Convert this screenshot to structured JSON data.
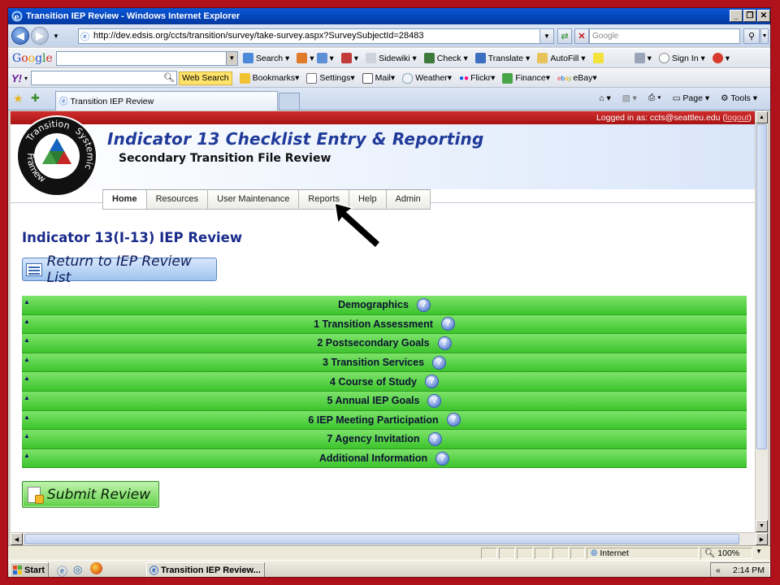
{
  "window": {
    "title": "Transition IEP Review - Windows Internet Explorer",
    "controls": [
      "_",
      "Θ",
      "X"
    ]
  },
  "address_bar": {
    "url": "http://dev.edsis.org/ccts/transition/survey/take-survey.aspx?SurveySubjectId=28483",
    "search_placeholder": "Google"
  },
  "google_toolbar": {
    "brand": "Google",
    "items": [
      "Search",
      "Sidewiki",
      "Check",
      "Translate",
      "AutoFill",
      "Sign In"
    ]
  },
  "yahoo_toolbar": {
    "brand": "Y!",
    "web_search": "Web Search",
    "items": [
      "Bookmarks",
      "Settings",
      "Mail",
      "Weather",
      "Flickr",
      "Finance",
      "eBay"
    ]
  },
  "tab_bar": {
    "tab_label": "Transition IEP Review",
    "commands": [
      "Page",
      "Tools"
    ]
  },
  "page": {
    "login_prefix": "Logged in as: ccts@seattleu.edu (",
    "logout": "logout",
    "login_suffix": ")",
    "logo_words": [
      "Transition",
      "Systemic",
      "Framework"
    ],
    "app_title": "Indicator 13 Checklist Entry & Reporting",
    "app_subtitle": "Secondary Transition File Review",
    "nav": [
      "Home",
      "Resources",
      "User Maintenance",
      "Reports",
      "Help",
      "Admin"
    ],
    "heading": "Indicator 13(I-13) IEP Review",
    "return_button": "Return to IEP Review List",
    "sections": [
      "Demographics",
      "1 Transition Assessment",
      "2 Postsecondary Goals",
      "3 Transition Services",
      "4 Course of Study",
      "5 Annual IEP Goals",
      "6 IEP Meeting Participation",
      "7 Agency Invitation",
      "Additional Information"
    ],
    "submit_button": "Submit Review"
  },
  "status_bar": {
    "zone": "Internet",
    "zoom": "100%"
  },
  "taskbar": {
    "start": "Start",
    "task": "Transition IEP Review...",
    "tray_chevron": "«",
    "time": "2:14 PM"
  },
  "colors": {
    "accent_red": "#b0121b",
    "section_green": "#4fce3b",
    "title_blue": "#1f3a99"
  }
}
